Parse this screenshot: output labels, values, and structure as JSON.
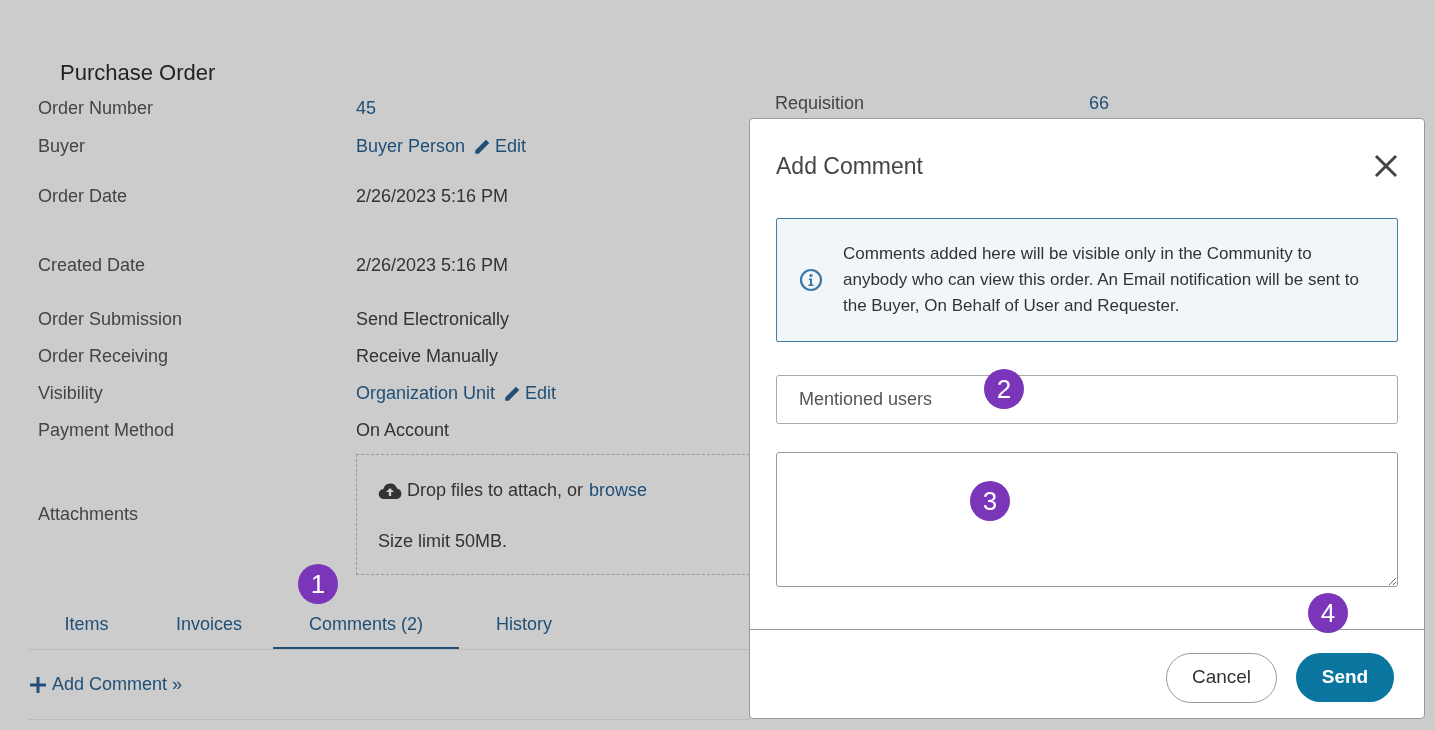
{
  "page": {
    "title": "Purchase Order"
  },
  "fields": [
    {
      "label": "Order Number",
      "value": "45",
      "kind": "link"
    },
    {
      "label": "Buyer",
      "value": "Buyer Person",
      "kind": "editable",
      "action": "Edit"
    },
    {
      "label": "Order Date",
      "value": "2/26/2023 5:16 PM",
      "kind": "text"
    },
    {
      "label": "Created Date",
      "value": "2/26/2023 5:16 PM",
      "kind": "text"
    },
    {
      "label": "Order Submission",
      "value": "Send Electronically",
      "kind": "text"
    },
    {
      "label": "Order Receiving",
      "value": "Receive Manually",
      "kind": "text"
    },
    {
      "label": "Visibility",
      "value": "Organization Unit",
      "kind": "editable",
      "action": "Edit"
    },
    {
      "label": "Payment Method",
      "value": "On Account",
      "kind": "text"
    }
  ],
  "side_field": {
    "label": "Requisition",
    "value": "66"
  },
  "attachments": {
    "label": "Attachments",
    "prompt": "Drop files to attach, or",
    "link": "browse",
    "note": "Size limit 50MB."
  },
  "tabs": [
    {
      "label": "Items",
      "selected": false
    },
    {
      "label": "Invoices",
      "selected": false
    },
    {
      "label": "Comments (2)",
      "selected": true
    },
    {
      "label": "History",
      "selected": false
    }
  ],
  "add_comment_link": "Add Comment »",
  "dialog": {
    "title": "Add Comment",
    "info": "Comments added here will be visible only in the Community to anybody who can view this order. An Email notification will be sent to the Buyer, On Behalf of User and Requester.",
    "mentions": {
      "placeholder": "Mentioned users"
    },
    "buttons": [
      {
        "label": "Cancel",
        "kind": "secondary"
      },
      {
        "label": "Send",
        "kind": "primary"
      }
    ]
  },
  "callouts": [
    "1",
    "2",
    "3",
    "4"
  ]
}
